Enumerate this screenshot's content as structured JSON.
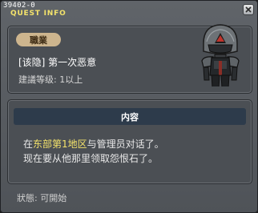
{
  "window": {
    "quest_id": "39402-0",
    "title": "QUEST INFO"
  },
  "info": {
    "job_badge": "職業",
    "quest_name": "[该隐] 第一次恶意",
    "recommended_level": "建議等级: 1以上",
    "npc_icon": "armored-knight-npc-portrait"
  },
  "content": {
    "header": "内容",
    "line1_prefix": "在",
    "line1_highlight": "东部第1地区",
    "line1_suffix": "与管理员对话了。",
    "line2": "现在要从他那里领取怨恨石了。",
    "highlight_color": "#f4e36b"
  },
  "status": {
    "text": "狀態: 可開始"
  },
  "colors": {
    "title": "#f4e36b",
    "badge": "#cdb58e",
    "header_bg": "#2d3b4b"
  }
}
